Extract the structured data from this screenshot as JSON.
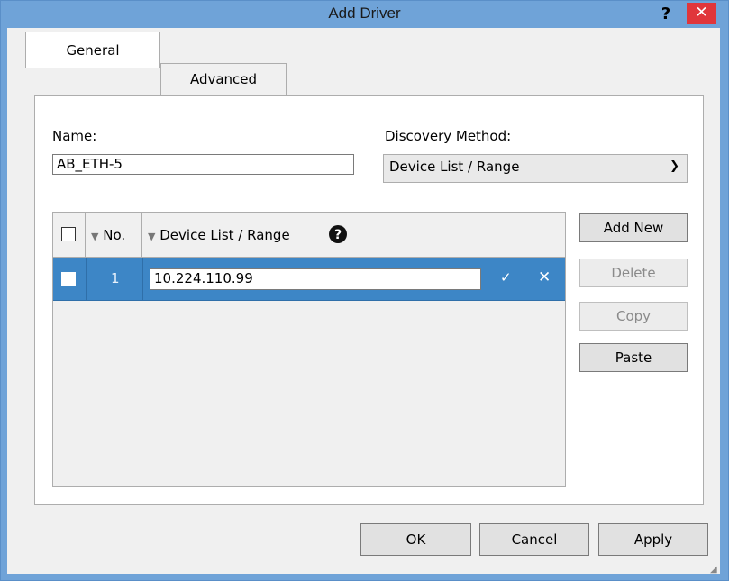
{
  "window": {
    "title": "Add Driver",
    "help_label": "?",
    "close_label": "✕"
  },
  "tabs": [
    {
      "label": "General",
      "active": true
    },
    {
      "label": "Advanced",
      "active": false
    }
  ],
  "form": {
    "name_label": "Name:",
    "name_value": "AB_ETH-5",
    "discovery_label": "Discovery Method:",
    "discovery_value": "Device List / Range"
  },
  "grid": {
    "columns": [
      {
        "label": "No."
      },
      {
        "label": "Device List / Range"
      }
    ],
    "help_icon": "question-circle-icon",
    "rows": [
      {
        "no": "1",
        "value": "10.224.110.99",
        "selected": true
      }
    ],
    "confirm_glyph": "✓",
    "cancel_glyph": "✕"
  },
  "side_buttons": {
    "add_new": "Add New",
    "delete": "Delete",
    "copy": "Copy",
    "paste": "Paste"
  },
  "footer": {
    "ok": "OK",
    "cancel": "Cancel",
    "apply": "Apply"
  },
  "colors": {
    "titlebar": "#6fa3d8",
    "close": "#e0363b",
    "selection": "#3d86c6"
  }
}
